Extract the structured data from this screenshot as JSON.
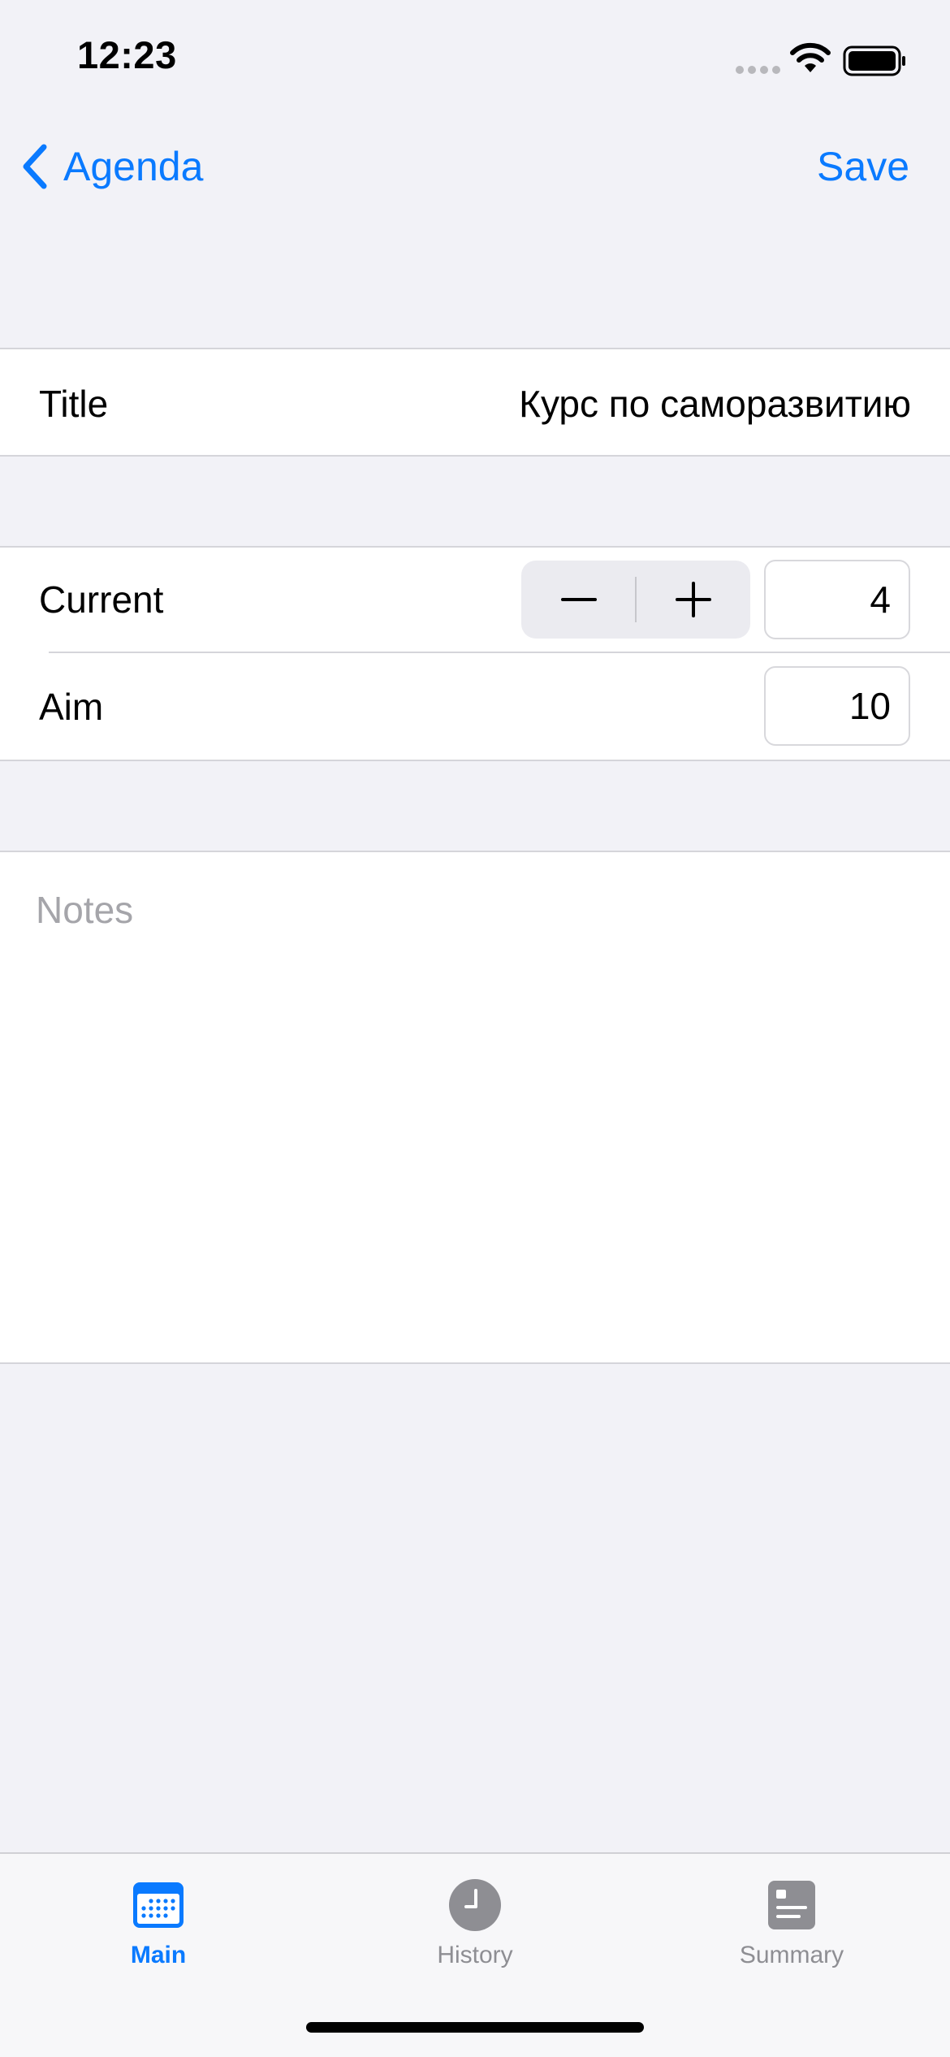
{
  "status_bar": {
    "time": "12:23",
    "signal_icon": "cellular-signal-icon",
    "wifi_icon": "wifi-icon",
    "battery_icon": "battery-icon"
  },
  "nav": {
    "back_label": "Agenda",
    "back_icon": "chevron-left-icon",
    "save_label": "Save",
    "accent_color": "#0A7AFF"
  },
  "form": {
    "title_label": "Title",
    "title_value": "Курс по саморазвитию",
    "current_label": "Current",
    "current_value": "4",
    "stepper_minus_icon": "minus-icon",
    "stepper_plus_icon": "plus-icon",
    "aim_label": "Aim",
    "aim_value": "10",
    "notes_placeholder": "Notes",
    "notes_value": ""
  },
  "tabbar": {
    "tabs": [
      {
        "label": "Main",
        "icon": "calendar-icon",
        "active": true
      },
      {
        "label": "History",
        "icon": "clock-icon",
        "active": false
      },
      {
        "label": "Summary",
        "icon": "summary-icon",
        "active": false
      }
    ],
    "active_color": "#0A7AFF",
    "inactive_color": "#8E8E93"
  },
  "colors": {
    "background": "#F2F2F7",
    "cell_background": "#FFFFFF",
    "separator": "#D5D5DA"
  }
}
